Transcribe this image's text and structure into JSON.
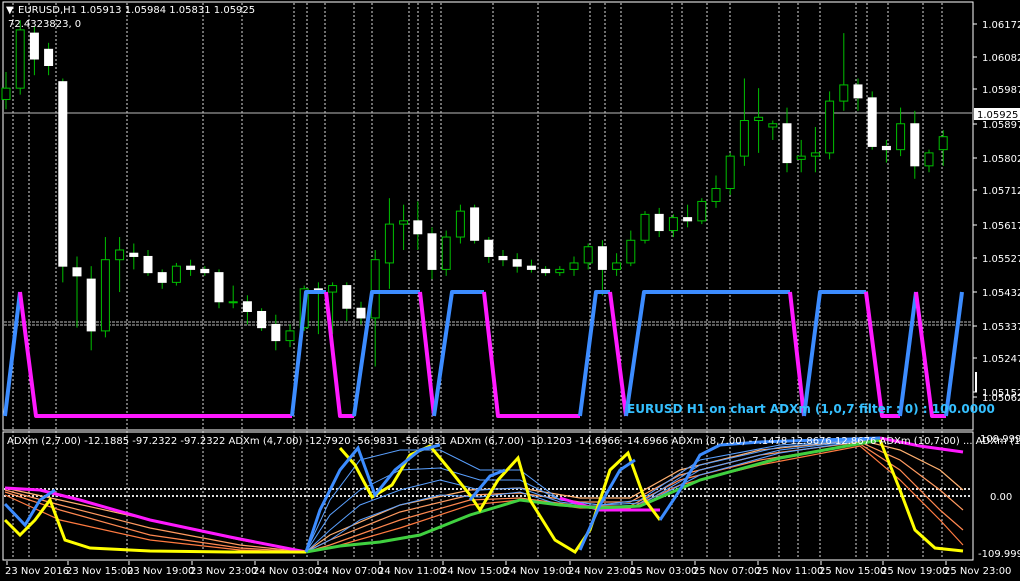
{
  "symbol_header": {
    "arrow_glyph": "▼",
    "text": "EURUSD,H1  1.05913 1.05984 1.05831 1.05925",
    "subvalue": "72.4323823, 0"
  },
  "price_axis": {
    "labels": [
      "1.06172",
      "1.06082",
      "1.05987",
      "1.05897",
      "1.05802",
      "1.05712",
      "1.05617",
      "1.05527",
      "1.05432",
      "1.05337",
      "1.05247",
      "1.05152",
      "1.05062"
    ],
    "current_price": "1.05925"
  },
  "indicator_axis": {
    "labels": [
      "109.9997",
      "0.00",
      "-109.9996"
    ]
  },
  "time_axis": {
    "labels": [
      "23 Nov 2016",
      "23 Nov 15:00",
      "23 Nov 19:00",
      "23 Nov 23:00",
      "24 Nov 03:00",
      "24 Nov 07:00",
      "24 Nov 11:00",
      "24 Nov 15:00",
      "24 Nov 19:00",
      "24 Nov 23:00",
      "25 Nov 03:00",
      "25 Nov 07:00",
      "25 Nov 11:00",
      "25 Nov 15:00",
      "25 Nov 19:00",
      "25 Nov 23:00"
    ]
  },
  "overlay_caption": "EURUSD H1 on chart ADXm (1,0,7 filter : 0) : 100.0000",
  "indicator_header": "ADXm (2,7.00) -12.1885 -97.2322 -97.2322   ADXm (4,7.00) -12.7920 -56.9831 -56.9831   ADXm (6,7.00) -10.1203 -14.6966 -14.6966   ADXm (8,7.00) -7.1478 12.8676 12.8676   ADXm (10,7.00) ...   ADXm (12,7.00)",
  "colors": {
    "background": "#000000",
    "bull_candle": "#00c000",
    "bear_candle": "#ffffff",
    "magenta": "#ff19ff",
    "blue": "#3c8cff",
    "yellow": "#ffff00",
    "green": "#40d040",
    "caption": "#35c0ff"
  },
  "chart_data": {
    "type": "candlestick",
    "symbol": "EURUSD",
    "timeframe": "H1",
    "ylim": [
      1.0501,
      1.0632
    ],
    "candles": [
      {
        "o": 1.06025,
        "h": 1.0611,
        "l": 1.05995,
        "c": 1.0606
      },
      {
        "o": 1.0606,
        "h": 1.0627,
        "l": 1.0604,
        "c": 1.0624
      },
      {
        "o": 1.0623,
        "h": 1.0625,
        "l": 1.061,
        "c": 1.0615
      },
      {
        "o": 1.0618,
        "h": 1.062,
        "l": 1.061,
        "c": 1.0613
      },
      {
        "o": 1.0608,
        "h": 1.0609,
        "l": 1.0546,
        "c": 1.0551
      },
      {
        "o": 1.05505,
        "h": 1.0554,
        "l": 1.0532,
        "c": 1.0548
      },
      {
        "o": 1.0547,
        "h": 1.0551,
        "l": 1.0525,
        "c": 1.0531
      },
      {
        "o": 1.0531,
        "h": 1.056,
        "l": 1.0529,
        "c": 1.0553
      },
      {
        "o": 1.0553,
        "h": 1.056,
        "l": 1.0543,
        "c": 1.0556
      },
      {
        "o": 1.0555,
        "h": 1.0558,
        "l": 1.055,
        "c": 1.0554
      },
      {
        "o": 1.0554,
        "h": 1.0556,
        "l": 1.0548,
        "c": 1.0549
      },
      {
        "o": 1.0549,
        "h": 1.055,
        "l": 1.0544,
        "c": 1.0546
      },
      {
        "o": 1.0546,
        "h": 1.0552,
        "l": 1.0545,
        "c": 1.0551
      },
      {
        "o": 1.0551,
        "h": 1.0553,
        "l": 1.0548,
        "c": 1.055
      },
      {
        "o": 1.055,
        "h": 1.0551,
        "l": 1.0548,
        "c": 1.0549
      },
      {
        "o": 1.0549,
        "h": 1.055,
        "l": 1.0538,
        "c": 1.054
      },
      {
        "o": 1.054,
        "h": 1.0545,
        "l": 1.0538,
        "c": 1.054
      },
      {
        "o": 1.054,
        "h": 1.0542,
        "l": 1.0533,
        "c": 1.0537
      },
      {
        "o": 1.0537,
        "h": 1.0538,
        "l": 1.0531,
        "c": 1.0532
      },
      {
        "o": 1.0533,
        "h": 1.0536,
        "l": 1.0525,
        "c": 1.0528
      },
      {
        "o": 1.0528,
        "h": 1.0533,
        "l": 1.0526,
        "c": 1.0531
      },
      {
        "o": 1.0532,
        "h": 1.0545,
        "l": 1.0531,
        "c": 1.0544
      },
      {
        "o": 1.0544,
        "h": 1.0546,
        "l": 1.053,
        "c": 1.0543
      },
      {
        "o": 1.0543,
        "h": 1.0546,
        "l": 1.053,
        "c": 1.0545
      },
      {
        "o": 1.0545,
        "h": 1.0546,
        "l": 1.0534,
        "c": 1.0538
      },
      {
        "o": 1.0538,
        "h": 1.054,
        "l": 1.0533,
        "c": 1.0535
      },
      {
        "o": 1.0535,
        "h": 1.0556,
        "l": 1.052,
        "c": 1.0553
      },
      {
        "o": 1.0552,
        "h": 1.0572,
        "l": 1.0544,
        "c": 1.0564
      },
      {
        "o": 1.0564,
        "h": 1.057,
        "l": 1.0556,
        "c": 1.0565
      },
      {
        "o": 1.0565,
        "h": 1.0571,
        "l": 1.0556,
        "c": 1.0561
      },
      {
        "o": 1.0561,
        "h": 1.0563,
        "l": 1.0547,
        "c": 1.055
      },
      {
        "o": 1.055,
        "h": 1.0562,
        "l": 1.0548,
        "c": 1.056
      },
      {
        "o": 1.056,
        "h": 1.057,
        "l": 1.0558,
        "c": 1.0568
      },
      {
        "o": 1.0569,
        "h": 1.057,
        "l": 1.0558,
        "c": 1.0559
      },
      {
        "o": 1.0559,
        "h": 1.056,
        "l": 1.0552,
        "c": 1.0554
      },
      {
        "o": 1.0554,
        "h": 1.0556,
        "l": 1.0551,
        "c": 1.0553
      },
      {
        "o": 1.0553,
        "h": 1.0555,
        "l": 1.0549,
        "c": 1.0551
      },
      {
        "o": 1.0551,
        "h": 1.0553,
        "l": 1.0549,
        "c": 1.055
      },
      {
        "o": 1.055,
        "h": 1.0551,
        "l": 1.0548,
        "c": 1.0549
      },
      {
        "o": 1.0549,
        "h": 1.0551,
        "l": 1.0548,
        "c": 1.055
      },
      {
        "o": 1.055,
        "h": 1.0554,
        "l": 1.0548,
        "c": 1.0552
      },
      {
        "o": 1.0552,
        "h": 1.0558,
        "l": 1.055,
        "c": 1.0557
      },
      {
        "o": 1.0557,
        "h": 1.0559,
        "l": 1.0542,
        "c": 1.055
      },
      {
        "o": 1.055,
        "h": 1.0555,
        "l": 1.0548,
        "c": 1.0552
      },
      {
        "o": 1.0552,
        "h": 1.0562,
        "l": 1.0551,
        "c": 1.0559
      },
      {
        "o": 1.0559,
        "h": 1.0568,
        "l": 1.0558,
        "c": 1.0567
      },
      {
        "o": 1.0567,
        "h": 1.0569,
        "l": 1.056,
        "c": 1.0562
      },
      {
        "o": 1.0562,
        "h": 1.0567,
        "l": 1.056,
        "c": 1.0566
      },
      {
        "o": 1.0566,
        "h": 1.057,
        "l": 1.0563,
        "c": 1.0565
      },
      {
        "o": 1.0565,
        "h": 1.0572,
        "l": 1.0564,
        "c": 1.0571
      },
      {
        "o": 1.0571,
        "h": 1.0579,
        "l": 1.0569,
        "c": 1.0575
      },
      {
        "o": 1.0575,
        "h": 1.0586,
        "l": 1.0573,
        "c": 1.0585
      },
      {
        "o": 1.0585,
        "h": 1.0609,
        "l": 1.0582,
        "c": 1.0596
      },
      {
        "o": 1.0596,
        "h": 1.0606,
        "l": 1.0586,
        "c": 1.0597
      },
      {
        "o": 1.0594,
        "h": 1.0596,
        "l": 1.059,
        "c": 1.0595
      },
      {
        "o": 1.0595,
        "h": 1.06,
        "l": 1.058,
        "c": 1.0583
      },
      {
        "o": 1.0584,
        "h": 1.059,
        "l": 1.058,
        "c": 1.0585
      },
      {
        "o": 1.0585,
        "h": 1.0594,
        "l": 1.058,
        "c": 1.0586
      },
      {
        "o": 1.0586,
        "h": 1.0605,
        "l": 1.0584,
        "c": 1.0602
      },
      {
        "o": 1.0602,
        "h": 1.0623,
        "l": 1.0599,
        "c": 1.0607
      },
      {
        "o": 1.0607,
        "h": 1.0609,
        "l": 1.0599,
        "c": 1.0603
      },
      {
        "o": 1.0603,
        "h": 1.0605,
        "l": 1.0587,
        "c": 1.0588
      },
      {
        "o": 1.0588,
        "h": 1.059,
        "l": 1.0583,
        "c": 1.0587
      },
      {
        "o": 1.0587,
        "h": 1.06,
        "l": 1.0585,
        "c": 1.0595
      },
      {
        "o": 1.0595,
        "h": 1.0599,
        "l": 1.0578,
        "c": 1.0582
      },
      {
        "o": 1.0582,
        "h": 1.0587,
        "l": 1.058,
        "c": 1.0586
      },
      {
        "o": 1.0587,
        "h": 1.0593,
        "l": 1.0582,
        "c": 1.0591
      }
    ]
  }
}
